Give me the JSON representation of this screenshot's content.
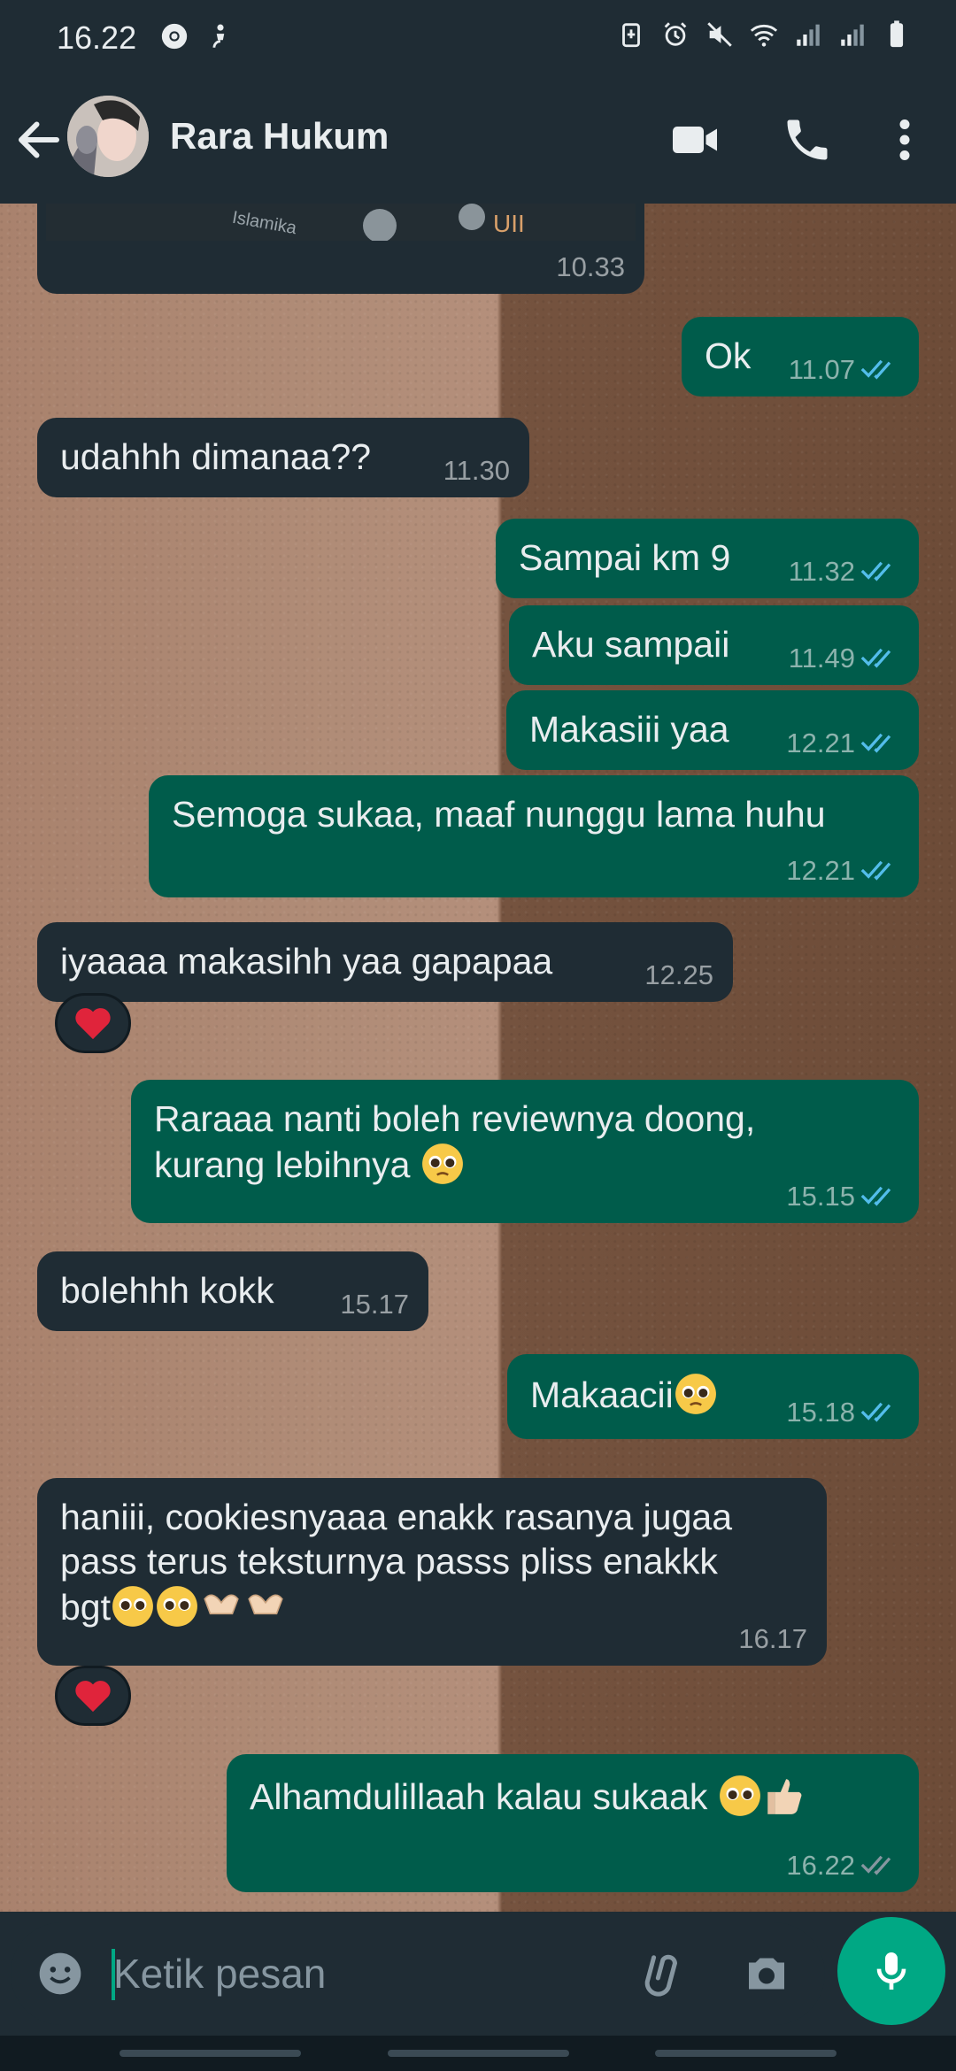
{
  "status_bar": {
    "time": "16.22"
  },
  "header": {
    "contact_name": "Rara Hukum"
  },
  "colors": {
    "incoming_bubble": "#1f2c34",
    "outgoing_bubble": "#005c4b",
    "accent": "#00a884",
    "read_ticks": "#53bdeb"
  },
  "map_preview": {
    "label_uii": "UII Yogyakarta",
    "label_islamika": "Islamika",
    "time": "10.33"
  },
  "messages": [
    {
      "direction": "out",
      "text": "Ok",
      "time": "11.07",
      "status": "read"
    },
    {
      "direction": "in",
      "text": "udahhh dimanaa??",
      "time": "11.30"
    },
    {
      "direction": "out",
      "text": "Sampai km 9",
      "time": "11.32",
      "status": "read"
    },
    {
      "direction": "out",
      "text": "Aku sampaii",
      "time": "11.49",
      "status": "read"
    },
    {
      "direction": "out",
      "text": "Makasiii yaa",
      "time": "12.21",
      "status": "read"
    },
    {
      "direction": "out",
      "text": "Semoga sukaa, maaf nunggu lama huhu",
      "time": "12.21",
      "status": "read"
    },
    {
      "direction": "in",
      "text": "iyaaaa makasihh yaa gapapaa",
      "time": "12.25",
      "reaction": "red-heart"
    },
    {
      "direction": "out",
      "text_line1": "Raraaa nanti boleh reviewnya doong,",
      "text_line2": "kurang lebihnya",
      "emoji": "pleading-face",
      "time": "15.15",
      "status": "read"
    },
    {
      "direction": "in",
      "text": "bolehhh kokk",
      "time": "15.17"
    },
    {
      "direction": "out",
      "text": "Makaacii",
      "emoji": "pleading-face",
      "time": "15.18",
      "status": "read"
    },
    {
      "direction": "in",
      "text_line1": "haniii, cookiesnyaaa enakk rasanya jugaa",
      "text_line2": "pass terus teksturnya passs pliss enakkk",
      "text_line3": "bgt",
      "emoji": "pleading-face-x2-heart-hands-x2",
      "time": "16.17",
      "reaction": "red-heart"
    },
    {
      "direction": "out",
      "text": "Alhamdulillaah kalau sukaak",
      "emoji": "pleading-face-thumbs-up",
      "time": "16.22",
      "status": "delivered"
    }
  ],
  "composer": {
    "placeholder": "Ketik pesan"
  },
  "icons": [
    "back-arrow-icon",
    "video-call-icon",
    "phone-icon",
    "more-vert-icon",
    "emoji-icon",
    "attach-icon",
    "camera-icon",
    "mic-icon"
  ]
}
